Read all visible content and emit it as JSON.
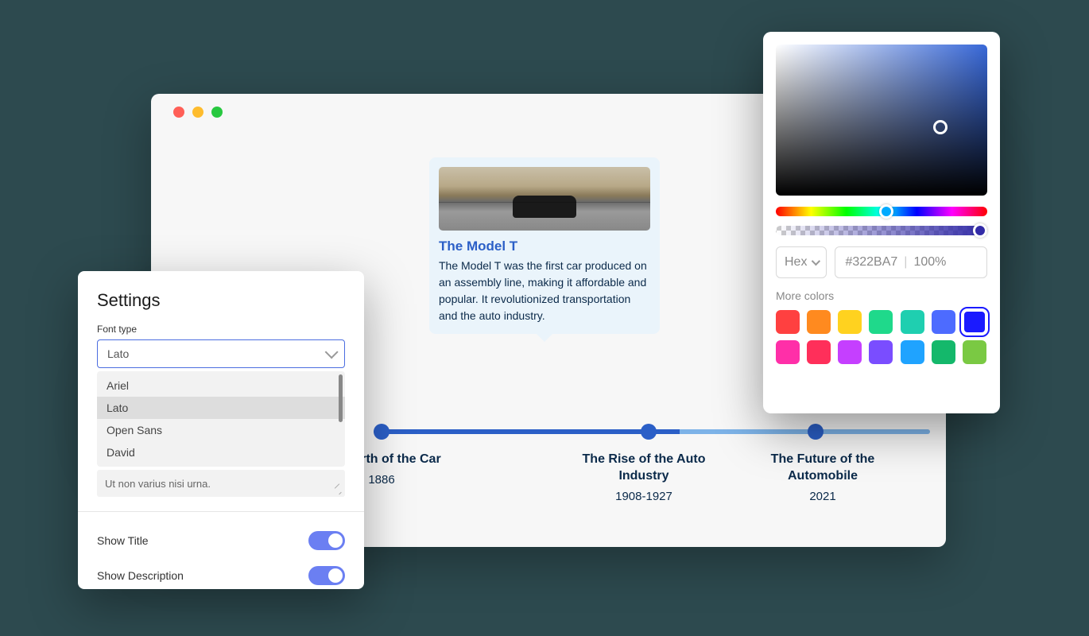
{
  "timeline": {
    "card": {
      "title": "The Model T",
      "description": "The Model T was the first car produced on an assembly line, making it affordable and popular. It revolutionized transportation and the auto industry."
    },
    "points": [
      {
        "title": "The Birth of the Car",
        "year": "1886"
      },
      {
        "title": "The Rise of the Auto Industry",
        "year": "1908-1927"
      },
      {
        "title": "The Future of the Automobile",
        "year": "2021"
      }
    ]
  },
  "settings": {
    "title": "Settings",
    "font_type_label": "Font type",
    "font_selected": "Lato",
    "font_options": [
      "Ariel",
      "Lato",
      "Open Sans",
      "David"
    ],
    "placeholder_text": "Ut non varius nisi urna.",
    "show_title_label": "Show Title",
    "show_title_on": true,
    "show_description_label": "Show Description",
    "show_description_on": true
  },
  "color_picker": {
    "format_label": "Hex",
    "hex_value": "#322BA7",
    "opacity_value": "100%",
    "more_colors_label": "More colors",
    "swatches": [
      "#ff4040",
      "#ff8a1f",
      "#ffd21f",
      "#1fd98b",
      "#1fcfb0",
      "#4d6bff",
      "#1a1aff",
      "#ff2fa8",
      "#ff2f5a",
      "#c53fff",
      "#7a4dff",
      "#1fa3ff",
      "#14b86b",
      "#7ac943"
    ],
    "selected_swatch_index": 6
  }
}
